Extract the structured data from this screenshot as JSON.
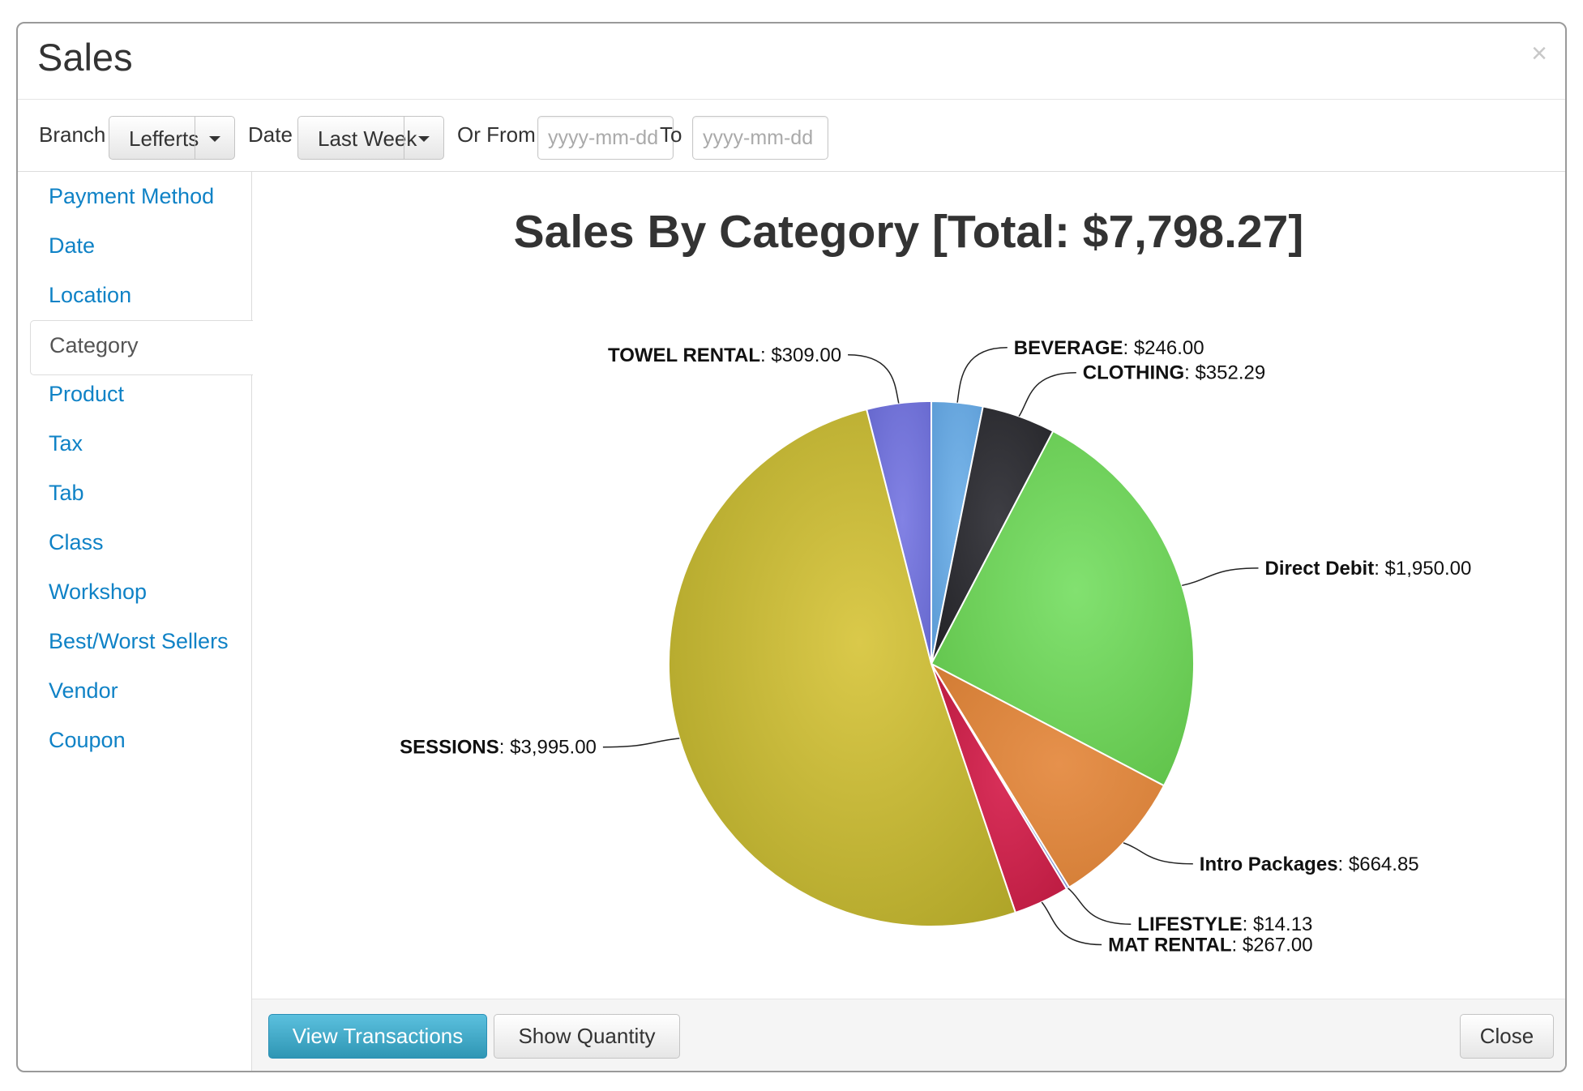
{
  "modal": {
    "title": "Sales",
    "close_glyph": "×"
  },
  "filters": {
    "branch_label": "Branch",
    "branch_value": "Lefferts",
    "date_label": "Date",
    "date_value": "Last Week",
    "from_label": "Or From",
    "from_placeholder": "yyyy-mm-dd",
    "to_label": "To",
    "to_placeholder": "yyyy-mm-dd"
  },
  "sidebar": {
    "active_index": 3,
    "items": [
      {
        "label": "Payment Method"
      },
      {
        "label": "Date"
      },
      {
        "label": "Location"
      },
      {
        "label": "Category"
      },
      {
        "label": "Product"
      },
      {
        "label": "Tax"
      },
      {
        "label": "Tab"
      },
      {
        "label": "Class"
      },
      {
        "label": "Workshop"
      },
      {
        "label": "Best/Worst Sellers"
      },
      {
        "label": "Vendor"
      },
      {
        "label": "Coupon"
      }
    ]
  },
  "chart_data": {
    "type": "pie",
    "title": "Sales By Category [Total: $7,798.27]",
    "slices": [
      {
        "name": "BEVERAGE",
        "value_label": "$246.00",
        "value": 246.0,
        "color": "#5b9bd5",
        "light": "#79b6ea"
      },
      {
        "name": "CLOTHING",
        "value_label": "$352.29",
        "value": 352.29,
        "color": "#222226",
        "light": "#3e3e44"
      },
      {
        "name": "Direct Debit",
        "value_label": "$1,950.00",
        "value": 1950.0,
        "color": "#5cbf46",
        "light": "#82e170"
      },
      {
        "name": "Intro Packages",
        "value_label": "$664.85",
        "value": 664.85,
        "color": "#d07a32",
        "light": "#e6914c"
      },
      {
        "name": "LIFESTYLE",
        "value_label": "$14.13",
        "value": 14.13,
        "color": "#7a8ccc",
        "light": "#9aaae0"
      },
      {
        "name": "MAT RENTAL",
        "value_label": "$267.00",
        "value": 267.0,
        "color": "#b8193e",
        "light": "#d9305a"
      },
      {
        "name": "SESSIONS",
        "value_label": "$3,995.00",
        "value": 3995.0,
        "color": "#aba125",
        "light": "#dac94a"
      },
      {
        "name": "TOWEL RENTAL",
        "value_label": "$309.00",
        "value": 309.0,
        "color": "#6466cc",
        "light": "#8282e4"
      }
    ]
  },
  "footer": {
    "view_transactions": "View Transactions",
    "show_quantity": "Show Quantity",
    "close": "Close"
  },
  "colors": {
    "link": "#0f82c6",
    "primary_button": "#3aa5c9"
  }
}
